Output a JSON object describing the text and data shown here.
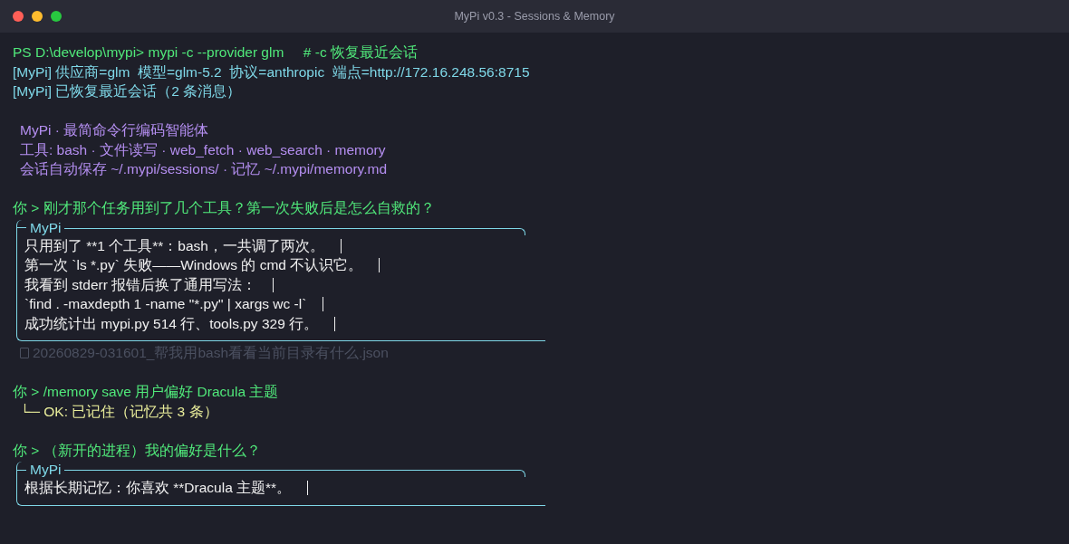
{
  "window": {
    "title": "MyPi v0.3 - Sessions & Memory"
  },
  "lines": [
    {
      "kind": "prompt",
      "text": "PS D:\\develop\\mypi> mypi -c --provider glm     # -c 恢复最近会话"
    },
    {
      "kind": "info",
      "text": "[MyPi] 供应商=glm  模型=glm-5.2  协议=anthropic  端点=http://172.16.248.56:8715"
    },
    {
      "kind": "info",
      "text": "[MyPi] 已恢复最近会话（2 条消息）"
    },
    {
      "kind": "blank"
    },
    {
      "kind": "banner",
      "text": "MyPi · 最简命令行编码智能体"
    },
    {
      "kind": "banner",
      "text": "工具: bash · 文件读写 · web_fetch · web_search · memory"
    },
    {
      "kind": "banner",
      "text": "会话自动保存 ~/.mypi/sessions/ · 记忆 ~/.mypi/memory.md"
    },
    {
      "kind": "blank"
    },
    {
      "kind": "prompt",
      "text": "你 > 刚才那个任务用到了几个工具？第一次失败后是怎么自救的？"
    },
    {
      "kind": "reply",
      "title": "MyPi",
      "lines": [
        "只用到了 **1 个工具**：bash，一共调了两次。",
        "第一次 `ls *.py` 失败——Windows 的 cmd 不认识它。",
        "我看到 stderr 报错后换了通用写法：",
        "`find . -maxdepth 1 -name \"*.py\" | xargs wc -l`",
        "成功统计出 mypi.py 514 行、tools.py 329 行。"
      ]
    },
    {
      "kind": "file",
      "text": "20260829-031601_帮我用bash看看当前目录有什么.json"
    },
    {
      "kind": "blank"
    },
    {
      "kind": "prompt",
      "text": "你 > /memory save 用户偏好 Dracula 主题"
    },
    {
      "kind": "result",
      "text": "└─ OK: 已记住（记忆共 3 条）"
    },
    {
      "kind": "blank"
    },
    {
      "kind": "prompt",
      "text": "你 > （新开的进程）我的偏好是什么？"
    },
    {
      "kind": "reply",
      "title": "MyPi",
      "lines": [
        "根据长期记忆：你喜欢 **Dracula 主题**。"
      ]
    }
  ]
}
